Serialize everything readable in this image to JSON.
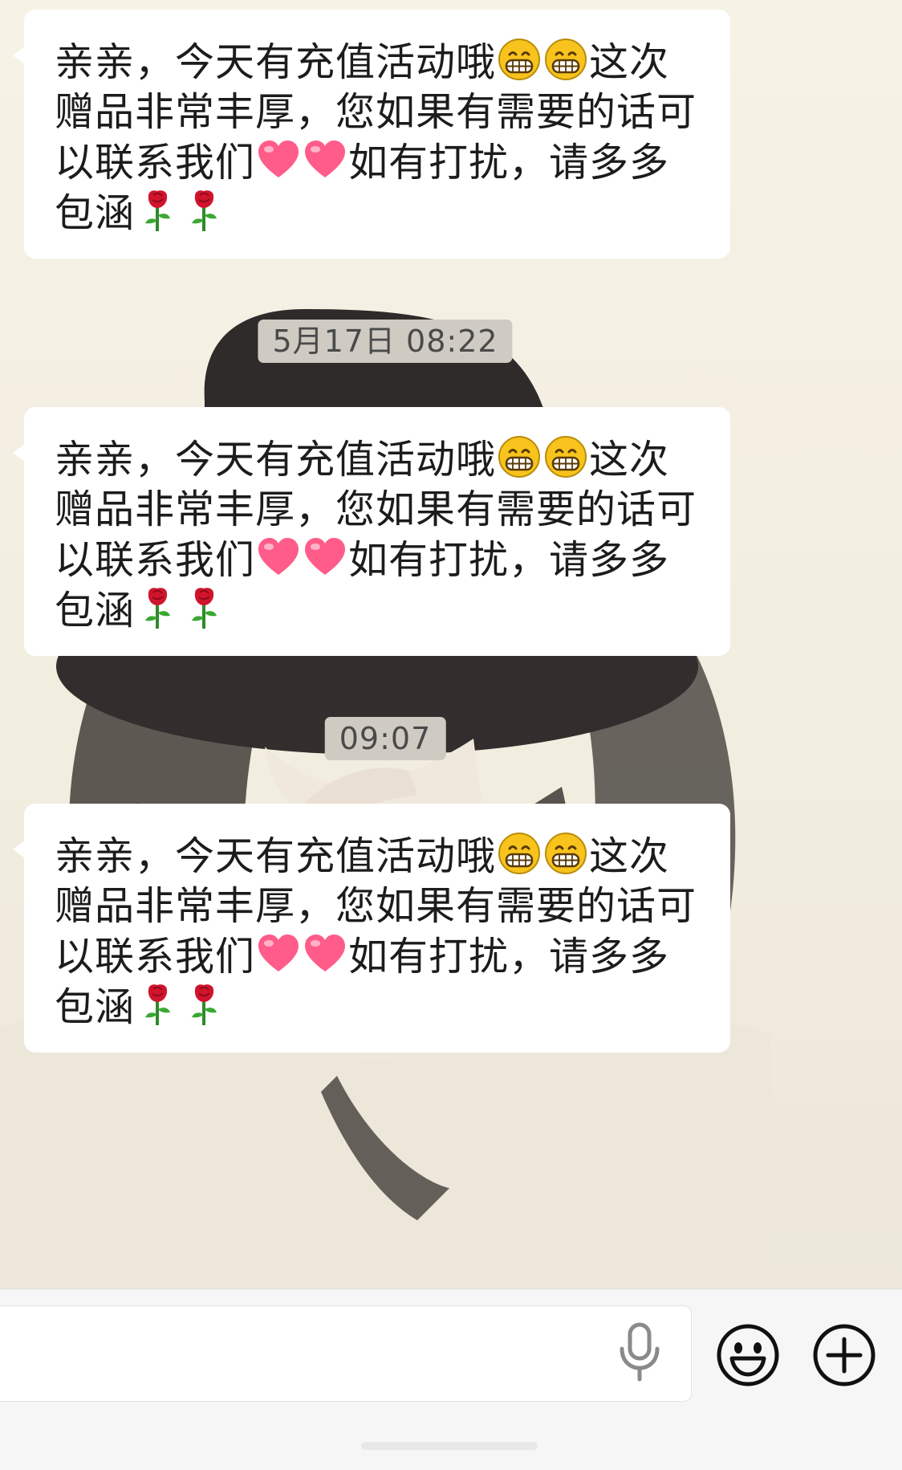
{
  "conversation": {
    "messages": [
      {
        "lines": [
          [
            "亲亲，今天有充值活动哦",
            "grin-emoji",
            "grin-emoji",
            "这次"
          ],
          [
            "赠品非常丰厚，您如果有需要的话可"
          ],
          [
            "以联系我们",
            "heart-emoji",
            "heart-emoji",
            "如有打扰，请多多"
          ],
          [
            "包涵",
            "rose-emoji",
            "rose-emoji"
          ]
        ]
      },
      {
        "lines": [
          [
            "亲亲，今天有充值活动哦",
            "grin-emoji",
            "grin-emoji",
            "这次"
          ],
          [
            "赠品非常丰厚，您如果有需要的话可"
          ],
          [
            "以联系我们",
            "heart-emoji",
            "heart-emoji",
            "如有打扰，请多多"
          ],
          [
            "包涵",
            "rose-emoji",
            "rose-emoji"
          ]
        ]
      },
      {
        "lines": [
          [
            "亲亲，今天有充值活动哦",
            "grin-emoji",
            "grin-emoji",
            "这次"
          ],
          [
            "赠品非常丰厚，您如果有需要的话可"
          ],
          [
            "以联系我们",
            "heart-emoji",
            "heart-emoji",
            "如有打扰，请多多"
          ],
          [
            "包涵",
            "rose-emoji",
            "rose-emoji"
          ]
        ]
      }
    ],
    "timestamps": [
      "5月17日 08:22",
      "09:07"
    ]
  },
  "input_bar": {
    "message_value": "",
    "icons": [
      "microphone-icon",
      "emoji-icon",
      "plus-icon"
    ]
  },
  "colors": {
    "bubble": "#ffffff",
    "timestamp_bg": "#cfcbc3",
    "heart": "#ff5c8a",
    "rose": "#d0142c",
    "grin": "#f7c31c"
  }
}
